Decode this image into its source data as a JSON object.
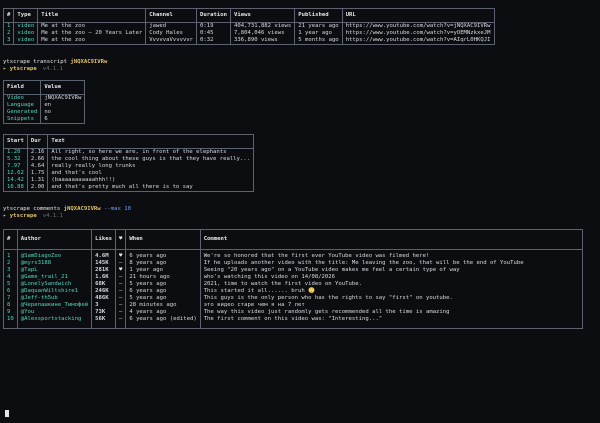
{
  "videos_table": {
    "headers": [
      "#",
      "Type",
      "Title",
      "Channel",
      "Duration",
      "Views",
      "Published",
      "URL"
    ],
    "rows": [
      [
        "1",
        "video",
        "Me at the zoo",
        "jawed",
        "0:19",
        "404,731,882 views",
        "21 years ago",
        "https://www.youtube.com/watch?v=jNQXAC9IVRw"
      ],
      [
        "2",
        "video",
        "Me at the zoo — 20 Years Later",
        "Cody Hales",
        "0:45",
        "7,804,046 views",
        "1 year ago",
        "https://www.youtube.com/watch?v=yOEMNzkxeJM"
      ],
      [
        "3",
        "video",
        "Me at the zoo",
        "VvvvvaVvvvvvr",
        "0:32",
        "336,890 views",
        "5 months ago",
        "https://www.youtube.com/watch?v=AIqrL0HKQJI"
      ]
    ]
  },
  "cmd1": {
    "prefix": "ytscrape transcript ",
    "arg": "jNQXAC9IVRw",
    "arrow": "▸",
    "app": "ytscrape",
    "version": "v4.1.1"
  },
  "field_table": {
    "headers": [
      "Field",
      "Value"
    ],
    "rows": [
      [
        "Video",
        "jNQXAC9IVRw"
      ],
      [
        "Language",
        "en"
      ],
      [
        "Generated",
        "no"
      ],
      [
        "Snippets",
        "6"
      ]
    ]
  },
  "transcript_table": {
    "headers": [
      "Start",
      "Dur",
      "Text"
    ],
    "rows": [
      [
        "1.20",
        "2.16",
        "All right, so here we are, in front of the elephants"
      ],
      [
        "5.32",
        "2.66",
        "the cool thing about these guys is that they have really..."
      ],
      [
        "7.97",
        "4.64",
        "really really long trunks"
      ],
      [
        "12.62",
        "1.75",
        "and that's cool"
      ],
      [
        "14.42",
        "1.31",
        "(baaaaaaaaaaahhh!!)"
      ],
      [
        "16.88",
        "2.00",
        "and that's pretty much all there is to say"
      ]
    ]
  },
  "cmd2": {
    "prefix": "ytscrape comments ",
    "arg": "jNQXAC9IVRw",
    "flag": " --max 10",
    "arrow": "▸",
    "app": "ytscrape",
    "version": "v4.1.1"
  },
  "comments_table": {
    "headers": [
      "#",
      "Author",
      "Likes",
      "♥",
      "When",
      "Comment"
    ],
    "rows": [
      [
        "1",
        "@SamDiagoZoo",
        "4.6M",
        "♥",
        "6 years ago",
        "We're so honored that the first ever YouTube video was filmed here!"
      ],
      [
        "2",
        "@myrs3188",
        "145K",
        "–",
        "8 years ago",
        "If he uploads another video with the title: Me leaving the zoo, that will be the end of YouTube"
      ],
      [
        "3",
        "@TapL",
        "281K",
        "♥",
        "1 year ago",
        "Seeing \"20 years ago\" on a YouTube video makes me feel a certain type of way"
      ],
      [
        "4",
        "@Game_trail_21",
        "1.6K",
        "–",
        "21 hours ago",
        "who's watching this video on 14/08/2026"
      ],
      [
        "5",
        "@LonelySandwich",
        "68K",
        "–",
        "5 years ago",
        "2021, time to watch the first video on YouTube."
      ],
      [
        "6",
        "@DaquanWiltshire1",
        "246K",
        "–",
        "6 years ago",
        "This started it all...... bruh 😳"
      ],
      [
        "7",
        "@Jeff-th5ub",
        "486K",
        "–",
        "5 years ago",
        "This guys is the only person who has the rights to say \"first\" on youtube."
      ],
      [
        "8",
        "@Черепашкине_Тимофей",
        "3",
        "–",
        "28 minutes ago",
        "это видео старе чем я на 7 лет"
      ],
      [
        "9",
        "@You",
        "73K",
        "–",
        "4 years ago",
        "The way this video just randomly gets recommended all the time is amazing"
      ],
      [
        "10",
        "@Alexsportstacking",
        "56K",
        "–",
        "6 years ago (edited)",
        "The first comment on this video was: \"Interesting...\""
      ]
    ]
  }
}
